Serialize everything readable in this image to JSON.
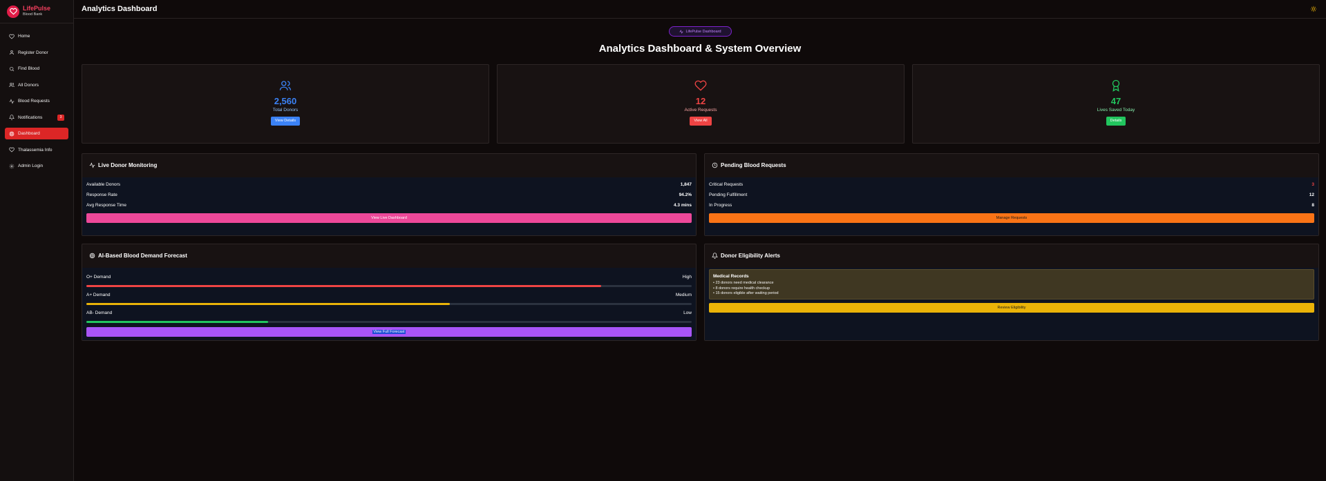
{
  "brand": {
    "name": "LifePulse",
    "subtitle": "Blood Bank"
  },
  "sidebar": {
    "items": [
      {
        "label": "Home",
        "icon": "heart-icon"
      },
      {
        "label": "Register Donor",
        "icon": "user-icon"
      },
      {
        "label": "Find Blood",
        "icon": "search-icon"
      },
      {
        "label": "All Donors",
        "icon": "users-icon"
      },
      {
        "label": "Blood Requests",
        "icon": "activity-icon"
      },
      {
        "label": "Notifications",
        "icon": "bell-icon",
        "badge": "3"
      },
      {
        "label": "Dashboard",
        "icon": "target-icon",
        "active": true
      },
      {
        "label": "Thalassemia Info",
        "icon": "heart-icon"
      },
      {
        "label": "Admin Login",
        "icon": "gear-icon"
      }
    ]
  },
  "header": {
    "title": "Analytics Dashboard",
    "theme_icon": "sun-icon"
  },
  "hero": {
    "pill": "LifePulse Dashboard",
    "title": "Analytics Dashboard & System Overview"
  },
  "stats": [
    {
      "value": "2,560",
      "label": "Total Donors",
      "button": "View Details",
      "color": "#3b82f6",
      "icon": "users-icon"
    },
    {
      "value": "12",
      "label": "Active Requests",
      "button": "View All",
      "color": "#ef4444",
      "icon": "heart-icon"
    },
    {
      "value": "47",
      "label": "Lives Saved Today",
      "button": "Details",
      "color": "#22c55e",
      "icon": "award-icon"
    }
  ],
  "live": {
    "title": "Live Donor Monitoring",
    "rows": [
      {
        "label": "Available Donors",
        "value": "1,847"
      },
      {
        "label": "Response Rate",
        "value": "94.2%"
      },
      {
        "label": "Avg Response Time",
        "value": "4.3 mins"
      }
    ],
    "button": "View Live Dashboard",
    "color": "#ec4899"
  },
  "pending": {
    "title": "Pending Blood Requests",
    "rows": [
      {
        "label": "Critical Requests",
        "value": "3",
        "color": "#ef4444"
      },
      {
        "label": "Pending Fulfillment",
        "value": "12"
      },
      {
        "label": "In Progress",
        "value": "8"
      }
    ],
    "button": "Manage Requests",
    "color": "#f97316"
  },
  "forecast": {
    "title": "AI-Based Blood Demand Forecast",
    "items": [
      {
        "label": "O+ Demand",
        "level": "High",
        "fraction": 0.85,
        "color": "#ef4444"
      },
      {
        "label": "A+ Demand",
        "level": "Medium",
        "fraction": 0.6,
        "color": "#eab308"
      },
      {
        "label": "AB- Demand",
        "level": "Low",
        "fraction": 0.3,
        "color": "#22c55e"
      }
    ],
    "button": "View Full Forecast",
    "color": "#a855f7"
  },
  "eligibility": {
    "title": "Donor Eligibility Alerts",
    "box_title": "Medical Records",
    "lines": [
      "• 23 donors need medical clearance",
      "• 8 donors require health checkup",
      "• 15 donors eligible after waiting period"
    ],
    "button": "Review Eligibility",
    "color": "#eab308"
  }
}
